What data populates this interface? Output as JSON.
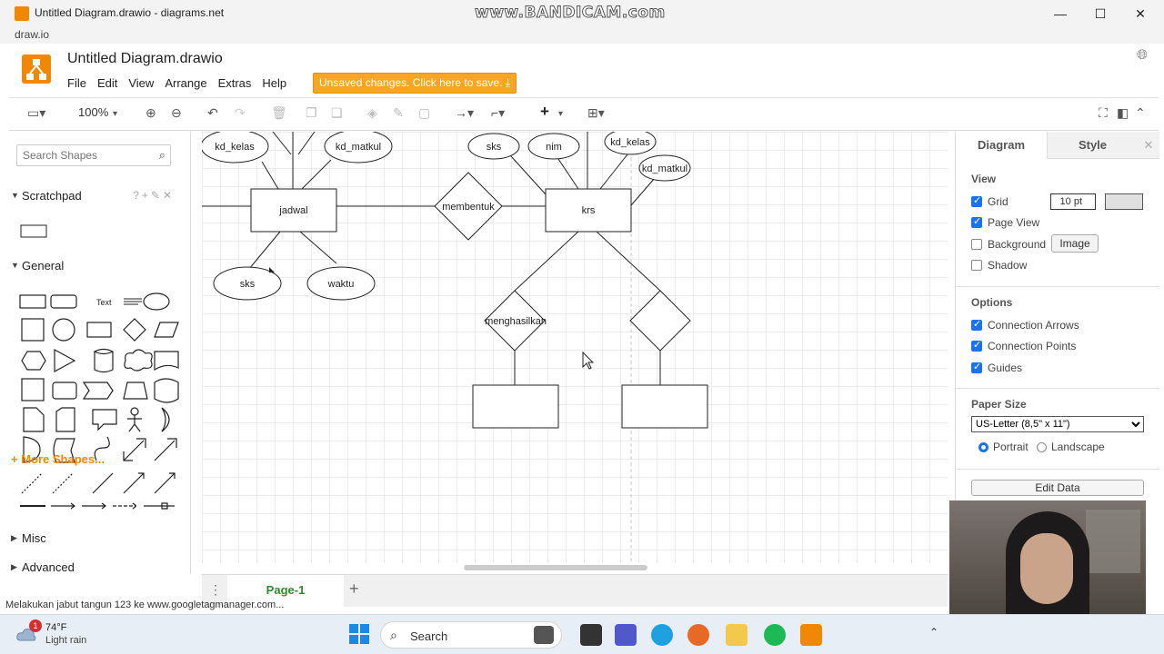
{
  "window": {
    "title": "Untitled Diagram.drawio - diagrams.net",
    "url": "draw.io",
    "watermark": "www.BANDICAM.com",
    "minimize": "—",
    "maximize": "☐",
    "close": "✕"
  },
  "header": {
    "doc_name": "Untitled Diagram.drawio",
    "menu": [
      "File",
      "Edit",
      "View",
      "Arrange",
      "Extras",
      "Help"
    ],
    "unsaved": "Unsaved changes. Click here to save."
  },
  "toolbar": {
    "zoom": "100%"
  },
  "left_panel": {
    "search_placeholder": "Search Shapes",
    "scratchpad": "Scratchpad",
    "general": "General",
    "text_shape": "Text",
    "misc": "Misc",
    "advanced": "Advanced",
    "more_shapes": "More Shapes..."
  },
  "diagram": {
    "entities": [
      "jadwal",
      "krs",
      "",
      ""
    ],
    "relationships": [
      "membentuk",
      "menghasilkan",
      ""
    ],
    "attributes": [
      "kd_kelas",
      "kd_matkul",
      "sks",
      "waktu",
      "sks",
      "nim",
      "kd_kelas",
      "kd_matkul"
    ]
  },
  "page_tabs": {
    "active": "Page-1",
    "add": "+"
  },
  "right_panel": {
    "tab_diagram": "Diagram",
    "tab_style": "Style",
    "view_heading": "View",
    "grid_label": "Grid",
    "grid_size": "10 pt",
    "page_view_label": "Page View",
    "background_label": "Background",
    "image_button": "Image",
    "shadow_label": "Shadow",
    "options_heading": "Options",
    "connection_arrows": "Connection Arrows",
    "connection_points": "Connection Points",
    "guides": "Guides",
    "paper_size_heading": "Paper Size",
    "paper_size_value": "US-Letter (8,5\" x 11\")",
    "portrait": "Portrait",
    "landscape": "Landscape",
    "edit_data": "Edit Data",
    "checks": {
      "grid": true,
      "page_view": true,
      "background": false,
      "shadow": false,
      "connection_arrows": true,
      "connection_points": true,
      "guides": true
    },
    "orientation": "Portrait"
  },
  "status_line": "Melakukan jabut tangun 123 ke www.googletagmanager.com...",
  "taskbar": {
    "weather_temp": "74°F",
    "weather_desc": "Light rain",
    "weather_badge": "1",
    "search": "Search"
  },
  "colors": {
    "accent": "#f08705",
    "unsaved_bg": "#f5a623",
    "checkbox": "#1a73e8",
    "page_tab_text": "#2d8a2d"
  }
}
